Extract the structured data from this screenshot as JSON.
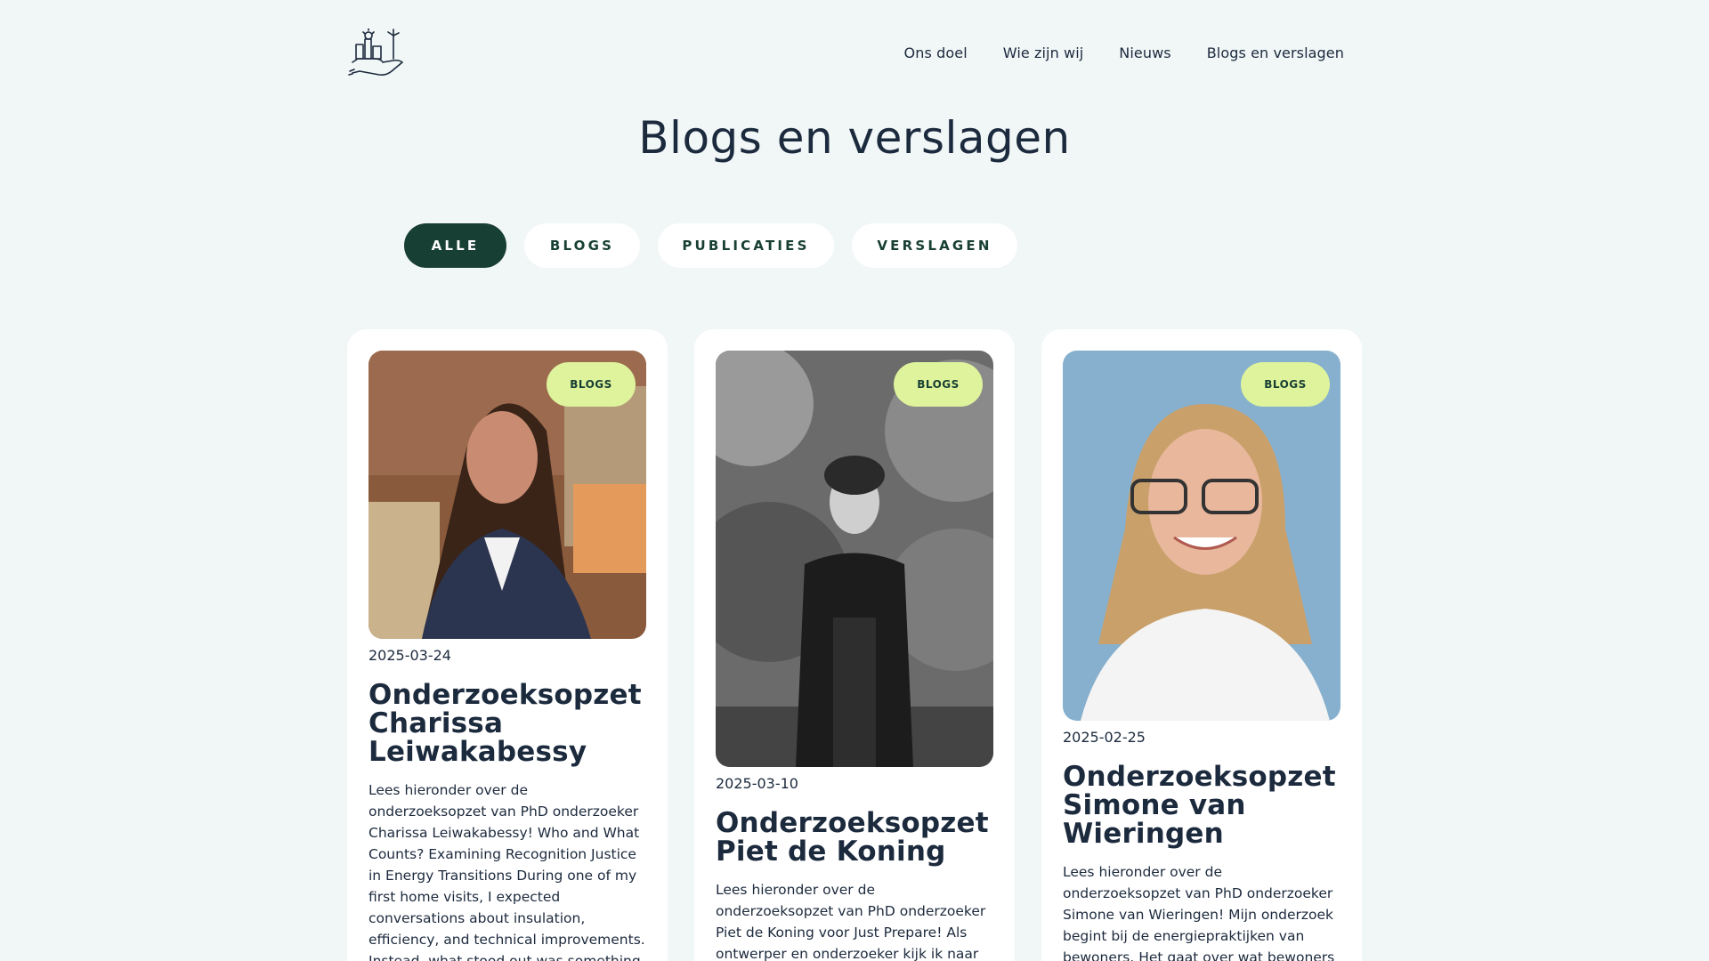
{
  "nav": {
    "items": [
      "Ons doel",
      "Wie zijn wij",
      "Nieuws",
      "Blogs en verslagen"
    ]
  },
  "page": {
    "title": "Blogs en verslagen"
  },
  "filters": {
    "items": [
      "ALLE",
      "BLOGS",
      "PUBLICATIES",
      "VERSLAGEN"
    ],
    "active": "ALLE"
  },
  "colors": {
    "background": "#f1f6f7",
    "accent_dark_green": "#183f33",
    "badge_lime": "#def39c",
    "text": "#1c2a3d"
  },
  "cards": [
    {
      "badge": "BLOGS",
      "date": "2025-03-24",
      "title": "Onderzoeksopzet Charissa Leiwakabessy",
      "excerpt": "Lees hieronder over de onderzoeksopzet van PhD onderzoeker Charissa Leiwakabessy! Who and What Counts? Examining Recognition Justice in Energy Transitions During one of my first home visits, I expected conversations about insulation, efficiency, and technical improvements. Instead, what stood out was something different - how the lived",
      "image_alt": "portrait-photo"
    },
    {
      "badge": "BLOGS",
      "date": "2025-03-10",
      "title": "Onderzoeksopzet Piet de Koning",
      "excerpt": "Lees hieronder over de onderzoeksopzet van PhD onderzoeker Piet de Koning voor Just Prepare! Als ontwerper en onderzoeker kijk ik naar hoe bewoners",
      "image_alt": "portrait-photo"
    },
    {
      "badge": "BLOGS",
      "date": "2025-02-25",
      "title": "Onderzoeksopzet Simone van Wieringen",
      "excerpt": "Lees hieronder over de onderzoeksopzet van PhD onderzoeker Simone van Wieringen! Mijn onderzoek begint bij de energiepraktijken van bewoners. Het gaat over wat bewoners zeggen en doen met",
      "image_alt": "portrait-photo"
    }
  ]
}
